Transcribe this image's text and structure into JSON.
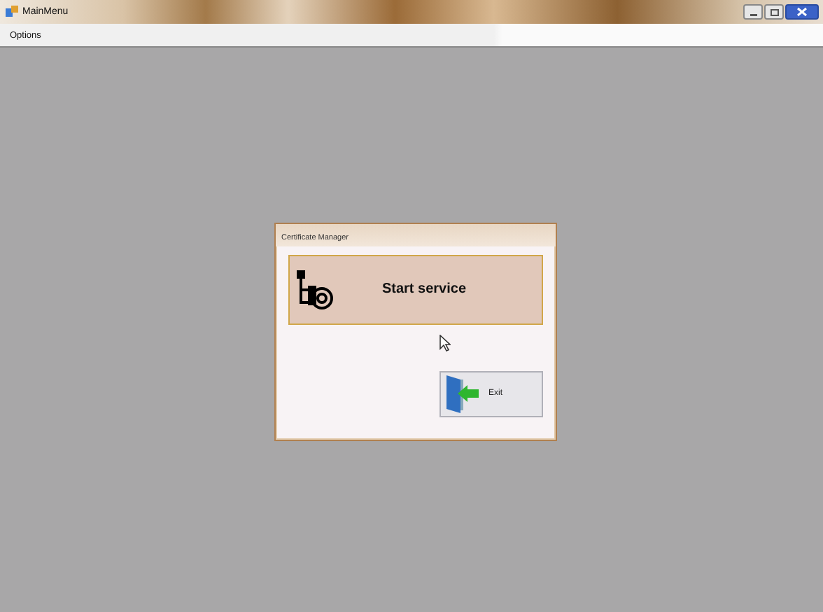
{
  "window": {
    "title": "MainMenu"
  },
  "menu": [
    "Options"
  ],
  "dialog": {
    "title": "Certificate Manager",
    "buttons": [
      {
        "label": "Start service",
        "kind": "primary"
      },
      {
        "label": "Exit",
        "kind": "exit"
      }
    ]
  }
}
